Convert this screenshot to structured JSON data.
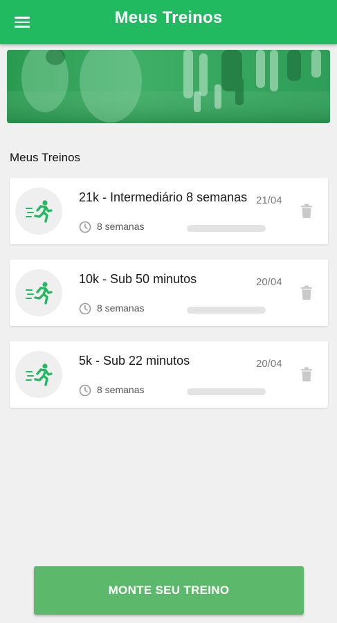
{
  "appbar": {
    "title": "Meus Treinos",
    "color": "#21ba61",
    "menu_icon": "hamburger-menu-icon"
  },
  "section": {
    "title": "Meus Treinos"
  },
  "workouts": [
    {
      "title": "21k - Intermediário 8 semanas",
      "date": "21/04",
      "duration": "8 semanas",
      "progress": 0,
      "icon": "runner-icon"
    },
    {
      "title": "10k - Sub 50 minutos",
      "date": "20/04",
      "duration": "8 semanas",
      "progress": 0,
      "icon": "runner-icon"
    },
    {
      "title": "5k - Sub 22 minutos",
      "date": "20/04",
      "duration": "8 semanas",
      "progress": 0,
      "icon": "runner-icon"
    }
  ],
  "cta": {
    "label": "MONTE SEU TREINO",
    "color": "#5cb86a"
  }
}
